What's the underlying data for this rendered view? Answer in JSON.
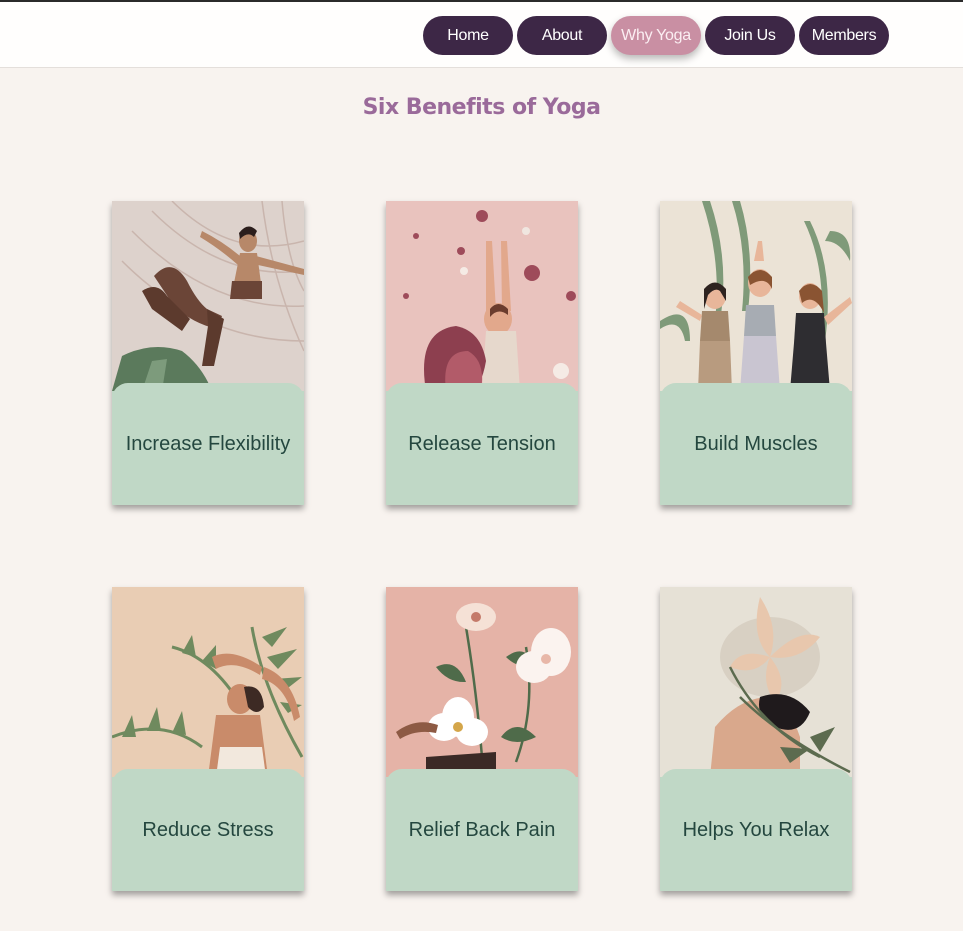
{
  "nav": {
    "items": [
      {
        "label": "Home",
        "active": false
      },
      {
        "label": "About",
        "active": false
      },
      {
        "label": "Why Yoga",
        "active": true
      },
      {
        "label": "Join Us",
        "active": false
      },
      {
        "label": "Members",
        "active": false
      }
    ]
  },
  "page": {
    "title": "Six Benefits of Yoga"
  },
  "cards": [
    {
      "label": "Increase Flexibility",
      "image": "yoga-dancer-pose-illustration"
    },
    {
      "label": "Release Tension",
      "image": "woman-arms-raised-flowers-illustration"
    },
    {
      "label": "Build Muscles",
      "image": "three-women-exercising-illustration"
    },
    {
      "label": "Reduce Stress",
      "image": "woman-stretching-palm-leaves-illustration"
    },
    {
      "label": "Relief Back Pain",
      "image": "woman-lying-flowers-illustration"
    },
    {
      "label": "Helps You Relax",
      "image": "woman-with-lily-flower-illustration"
    }
  ],
  "colors": {
    "nav_button": "#3d2746",
    "nav_active": "#c98fa3",
    "title": "#9a6a9a",
    "card_label_bg": "#c0d8c6",
    "card_label_text": "#24473f",
    "page_bg": "#f8f3ef"
  }
}
